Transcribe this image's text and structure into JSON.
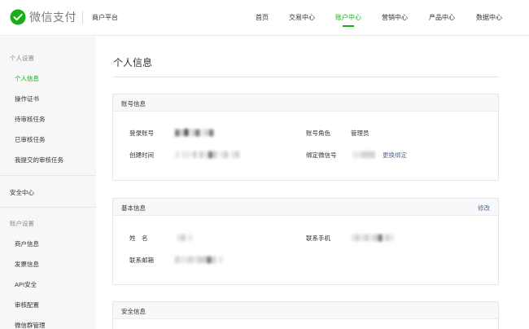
{
  "header": {
    "logo_text": "微信支付",
    "platform": "商户平台",
    "nav": [
      {
        "label": "首页",
        "active": false
      },
      {
        "label": "交易中心",
        "active": false
      },
      {
        "label": "账户中心",
        "active": true
      },
      {
        "label": "营销中心",
        "active": false
      },
      {
        "label": "产品中心",
        "active": false
      },
      {
        "label": "数据中心",
        "active": false
      }
    ]
  },
  "sidebar": {
    "group1": "个人设置",
    "group1_items": [
      "个人信息",
      "操作证书",
      "待审核任务",
      "已审核任务",
      "我提交的审核任务"
    ],
    "security_center": "安全中心",
    "group2": "账户设置",
    "group2_items": [
      "商户信息",
      "发票信息",
      "API安全",
      "审核配置",
      "微信群管理"
    ]
  },
  "main": {
    "title": "个人信息",
    "account_card": {
      "title": "账号信息",
      "login_label": "登录账号",
      "login_value": "▓▒█ ▒▓░▒▓",
      "created_label": "创建时间",
      "created_value": "░ ░░ ▒ ▒░▓▒ ░▒ ░▒",
      "role_label": "账号角色",
      "role_value": "管理员",
      "wechat_label": "绑定微信号",
      "wechat_value": "░░▒▒▒",
      "wechat_action": "更换绑定"
    },
    "basic_card": {
      "title": "基本信息",
      "action": "修改",
      "name_label": "姓　名",
      "name_value": "░▒ ░",
      "phone_label": "联系手机",
      "phone_value": "░▒░▒░▒▓ ▒░",
      "email_label": "联系邮箱",
      "email_value": "▒░░▒░▒▒▓▒ ░"
    },
    "security_card": {
      "title": "安全信息"
    }
  },
  "colors": {
    "accent": "#1aad19",
    "link": "#576b95",
    "sidebar_bg": "#f7f7f7"
  }
}
